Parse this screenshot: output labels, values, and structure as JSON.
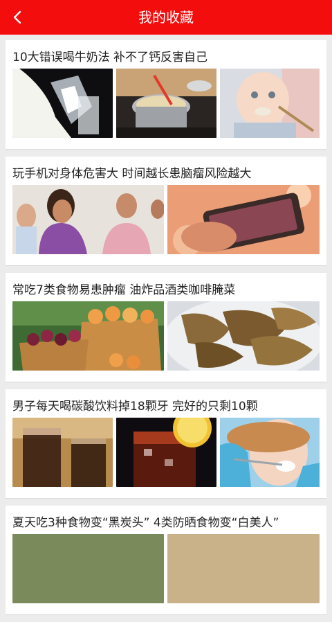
{
  "header": {
    "title": "我的收藏"
  },
  "articles": [
    {
      "title": "10大错误喝牛奶法 补不了钙反害自己"
    },
    {
      "title": "玩手机对身体危害大 时间越长患脑瘤风险越大"
    },
    {
      "title": "常吃7类食物易患肿瘤 油炸品酒类咖啡腌菜"
    },
    {
      "title": "男子每天喝碳酸饮料掉18颗牙 完好的只剩10颗"
    },
    {
      "title": "夏天吃3种食物变“黑炭头” 4类防晒食物变“白美人”"
    }
  ]
}
